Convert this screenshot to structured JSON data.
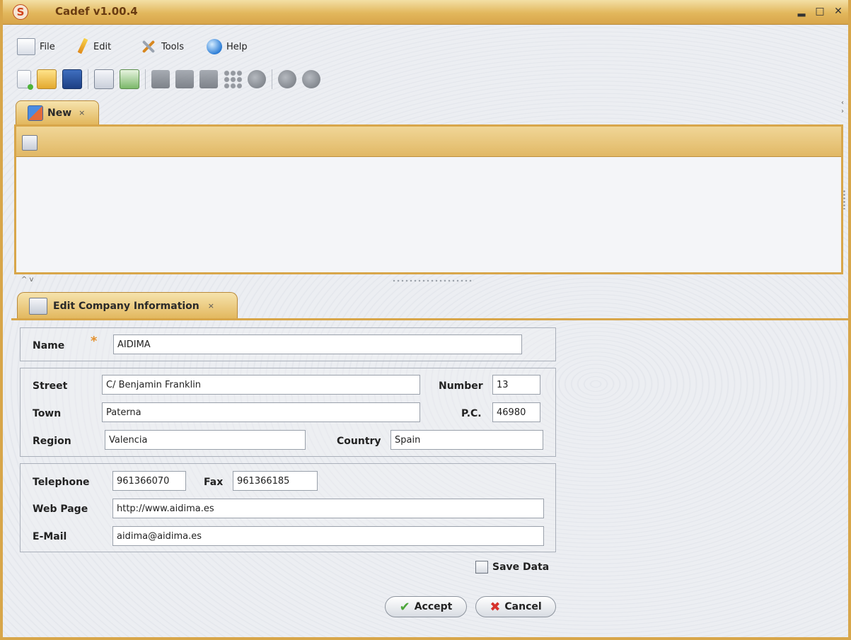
{
  "window": {
    "title": "Cadef v1.00.4",
    "logo_letter": "S",
    "minimize_glyph": "▂",
    "maximize_glyph": "□",
    "close_glyph": "✕"
  },
  "menu": {
    "file": "File",
    "edit": "Edit",
    "tools": "Tools",
    "help": "Help"
  },
  "tabs": {
    "top": {
      "label": "New",
      "close": "×"
    },
    "bottom": {
      "label": "Edit Company Information",
      "close": "×"
    },
    "collapse_arrows": "^ v"
  },
  "form": {
    "name_label": "Name",
    "name_value": "AIDIMA",
    "required_mark": "*",
    "street_label": "Street",
    "street_value": "C/ Benjamin Franklin",
    "number_label": "Number",
    "number_value": "13",
    "town_label": "Town",
    "town_value": "Paterna",
    "pc_label": "P.C.",
    "pc_value": "46980",
    "region_label": "Region",
    "region_value": "Valencia",
    "country_label": "Country",
    "country_value": "Spain",
    "telephone_label": "Telephone",
    "telephone_value": "961366070",
    "fax_label": "Fax",
    "fax_value": "961366185",
    "webpage_label": "Web Page",
    "webpage_value": "http://www.aidima.es",
    "email_label": "E-Mail",
    "email_value": "aidima@aidima.es",
    "save_data_label": "Save Data",
    "accept_label": "Accept",
    "cancel_label": "Cancel"
  },
  "colors": {
    "frame": "#d8a64a",
    "title_text": "#6a3c12",
    "required": "#e4902c"
  }
}
